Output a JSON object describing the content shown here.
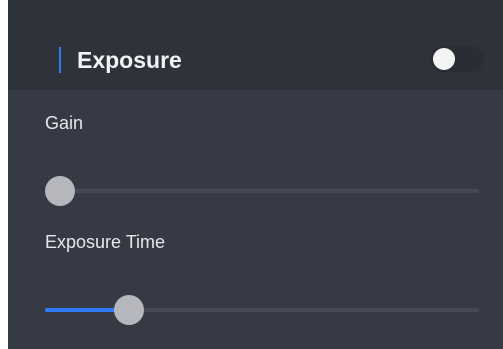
{
  "section": {
    "title": "Exposure",
    "accent_color": "#2f7df6",
    "toggle_on": false
  },
  "controls": [
    {
      "label": "Gain",
      "value_fraction": 0.0
    },
    {
      "label": "Exposure Time",
      "value_fraction": 0.17
    }
  ]
}
